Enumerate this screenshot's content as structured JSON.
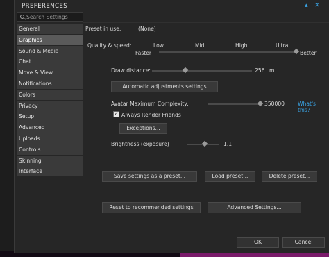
{
  "window": {
    "title": "PREFERENCES",
    "minimize_glyph": "▴",
    "close_glyph": "✕"
  },
  "search": {
    "placeholder": "Search Settings",
    "value": ""
  },
  "tabs": [
    "General",
    "Graphics",
    "Sound & Media",
    "Chat",
    "Move & View",
    "Notifications",
    "Colors",
    "Privacy",
    "Setup",
    "Advanced",
    "Uploads",
    "Controls",
    "Skinning",
    "Interface"
  ],
  "active_tab": "Graphics",
  "graphics": {
    "preset_label": "Preset in use:",
    "preset_value": "(None)",
    "quality_label": "Quality & speed:",
    "quality_levels": [
      "Low",
      "Mid",
      "High",
      "Ultra"
    ],
    "faster_label": "Faster",
    "better_label": "Better",
    "quality_level": 1.0,
    "draw_distance_label": "Draw distance:",
    "draw_distance_value": "256",
    "draw_distance_unit": "m",
    "draw_distance_fraction": 0.33,
    "auto_adjust_button": "Automatic adjustments settings",
    "avatar_complexity_label": "Avatar Maximum Complexity:",
    "avatar_complexity_value": "350000",
    "avatar_complexity_fraction": 1.0,
    "whats_this_link": "What's this?",
    "always_render_friends_label": "Always Render Friends",
    "always_render_friends_checked": true,
    "exceptions_button": "Exceptions...",
    "brightness_label": "Brightness (exposure)",
    "brightness_value": "1.1",
    "brightness_fraction": 0.55,
    "save_preset_button": "Save settings as a preset...",
    "load_preset_button": "Load preset...",
    "delete_preset_button": "Delete preset...",
    "reset_button": "Reset to recommended settings",
    "advanced_button": "Advanced Settings..."
  },
  "footer": {
    "ok_button": "OK",
    "cancel_button": "Cancel"
  },
  "colors": {
    "accent": "#3aa6e8",
    "window_bg": "#262626",
    "tab_active": "#5a5a5a",
    "tab_bg": "#3a3a3a"
  }
}
